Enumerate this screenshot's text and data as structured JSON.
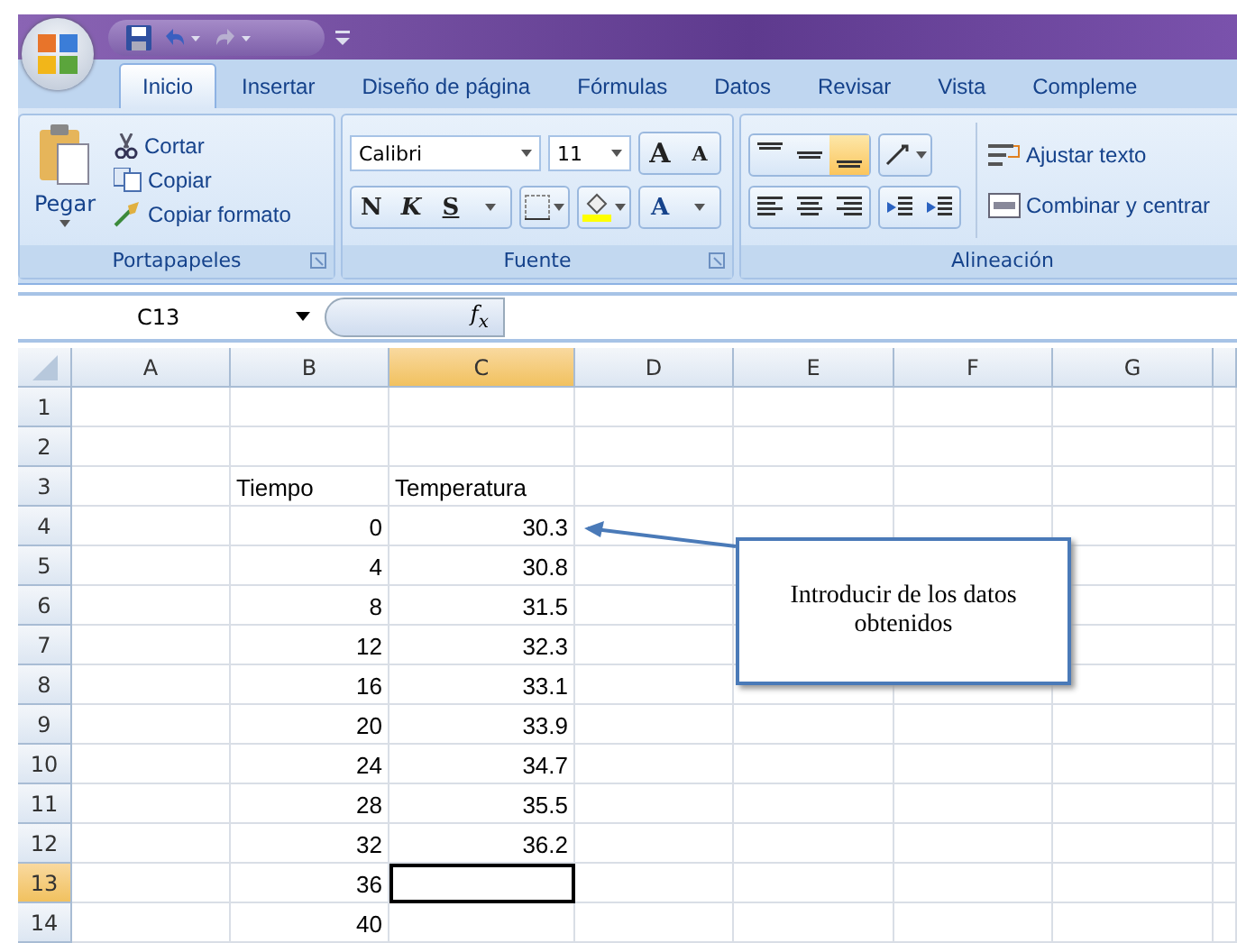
{
  "tabs": [
    {
      "label": "Inicio",
      "selected": true
    },
    {
      "label": "Insertar",
      "selected": false
    },
    {
      "label": "Diseño de página",
      "selected": false
    },
    {
      "label": "Fórmulas",
      "selected": false
    },
    {
      "label": "Datos",
      "selected": false
    },
    {
      "label": "Revisar",
      "selected": false
    },
    {
      "label": "Vista",
      "selected": false
    },
    {
      "label": "Compleme",
      "selected": false
    }
  ],
  "clipboard": {
    "paste": "Pegar",
    "cut": "Cortar",
    "copy": "Copiar",
    "format_painter": "Copiar formato",
    "label": "Portapapeles"
  },
  "font": {
    "name": "Calibri",
    "size": "11",
    "grow": "A",
    "shrink": "A",
    "bold": "N",
    "italic": "K",
    "underline": "S",
    "font_color": "A",
    "label": "Fuente"
  },
  "alignment": {
    "vertical": [
      {
        "kind": "top",
        "selected": false
      },
      {
        "kind": "middle",
        "selected": false
      },
      {
        "kind": "bottom",
        "selected": true
      }
    ],
    "wrap": "Ajustar texto",
    "merge": "Combinar y centrar",
    "label": "Alineación"
  },
  "formula_bar": {
    "name_box": "C13",
    "fx": "f$_{x}$"
  },
  "columns": [
    {
      "label": "A",
      "selected": false
    },
    {
      "label": "B",
      "selected": false
    },
    {
      "label": "C",
      "selected": true
    },
    {
      "label": "D",
      "selected": false
    },
    {
      "label": "E",
      "selected": false
    },
    {
      "label": "F",
      "selected": false
    },
    {
      "label": "G",
      "selected": false
    }
  ],
  "rows": [
    {
      "label": "1",
      "selected": false
    },
    {
      "label": "2",
      "selected": false
    },
    {
      "label": "3",
      "selected": false,
      "b": "Tiempo",
      "c": "Temperatura",
      "header": true
    },
    {
      "label": "4",
      "selected": false,
      "b": "0",
      "c": "30.3"
    },
    {
      "label": "5",
      "selected": false,
      "b": "4",
      "c": "30.8"
    },
    {
      "label": "6",
      "selected": false,
      "b": "8",
      "c": "31.5"
    },
    {
      "label": "7",
      "selected": false,
      "b": "12",
      "c": "32.3"
    },
    {
      "label": "8",
      "selected": false,
      "b": "16",
      "c": "33.1"
    },
    {
      "label": "9",
      "selected": false,
      "b": "20",
      "c": "33.9"
    },
    {
      "label": "10",
      "selected": false,
      "b": "24",
      "c": "34.7"
    },
    {
      "label": "11",
      "selected": false,
      "b": "28",
      "c": "35.5"
    },
    {
      "label": "12",
      "selected": false,
      "b": "32",
      "c": "36.2"
    },
    {
      "label": "13",
      "selected": true,
      "b": "36",
      "c_selected": true
    },
    {
      "label": "14",
      "selected": false,
      "b": "40"
    }
  ],
  "callout": {
    "text": "Introducir de los datos obtenidos"
  }
}
